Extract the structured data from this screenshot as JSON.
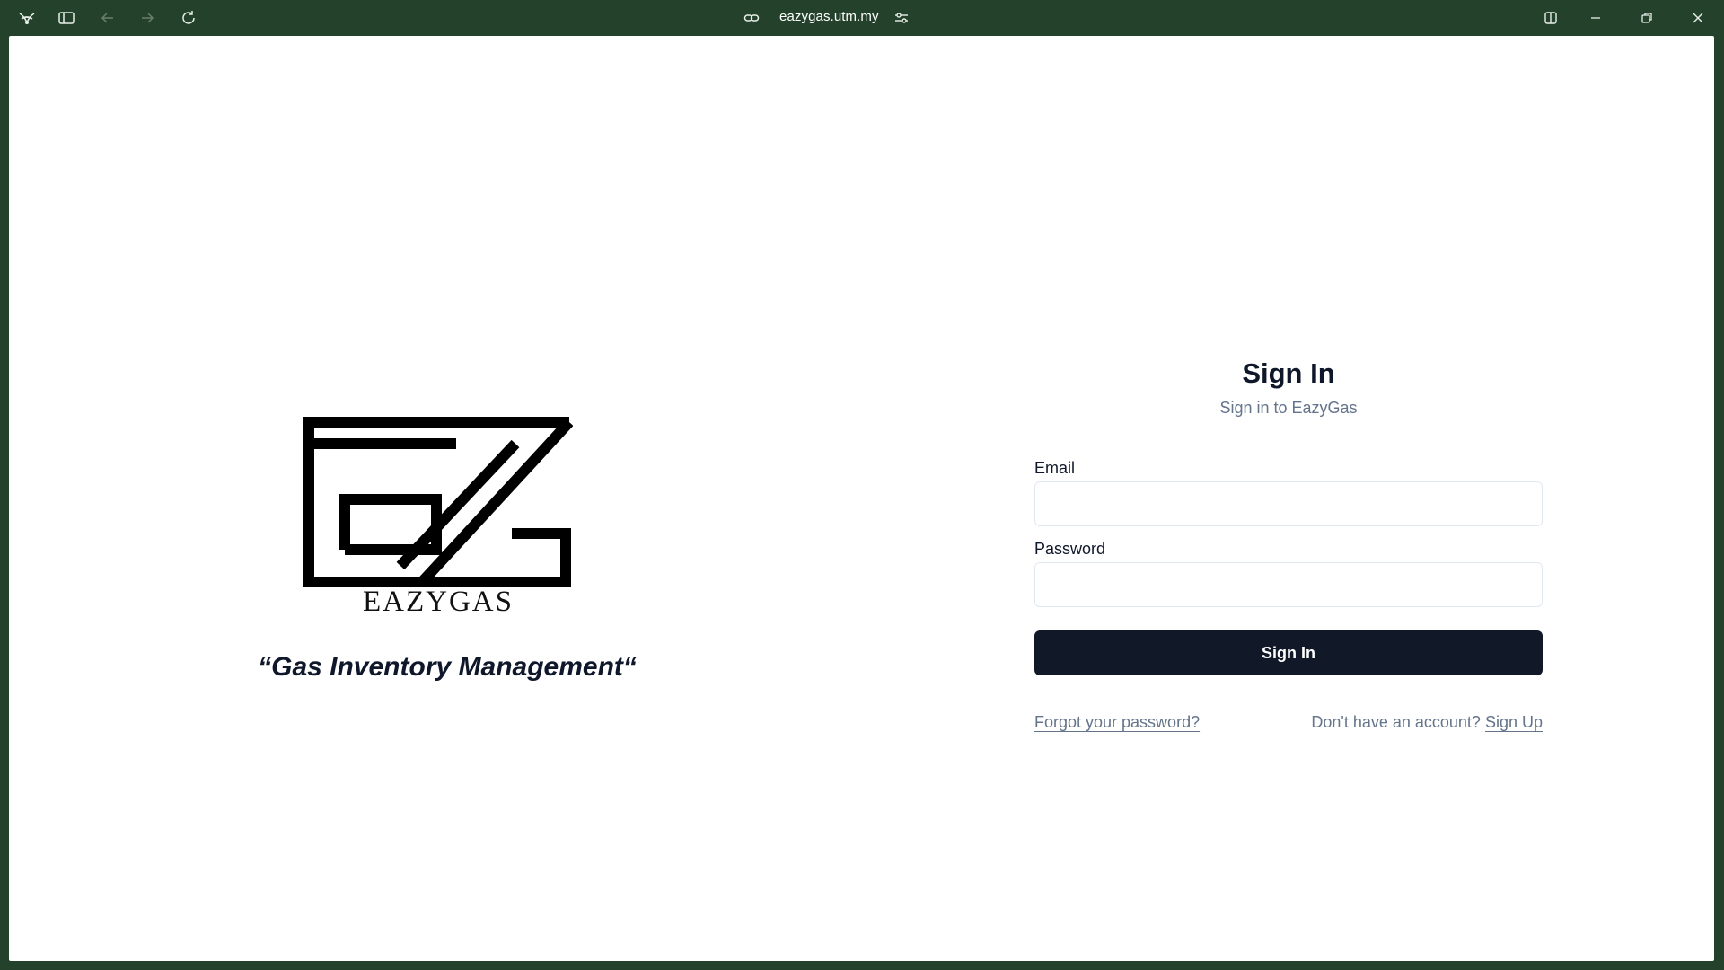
{
  "browser": {
    "url": "eazygas.utm.my",
    "icons": {
      "app": "browser-logo-icon",
      "sidebar": "sidebar-toggle-icon",
      "back": "back-arrow-icon",
      "forward": "forward-arrow-icon",
      "reload": "reload-icon",
      "link": "link-icon",
      "settings": "site-settings-icon",
      "split": "split-view-icon",
      "minimize": "minimize-icon",
      "restore": "restore-icon",
      "close": "close-icon"
    },
    "chrome_color": "#24422b"
  },
  "brand": {
    "logo_word": "EAZYGAS",
    "tagline": "“Gas Inventory Management“"
  },
  "signin": {
    "title": "Sign In",
    "subtitle": "Sign in to EazyGas",
    "email_label": "Email",
    "email_value": "",
    "password_label": "Password",
    "password_value": "",
    "button_label": "Sign In",
    "forgot_label": "Forgot your password?",
    "no_account_text": "Don't have an account?",
    "signup_label": "Sign Up",
    "button_color": "#111827"
  }
}
